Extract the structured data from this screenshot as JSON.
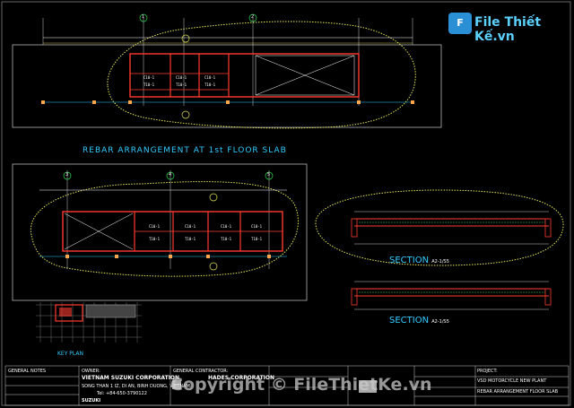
{
  "watermark": {
    "logo_letter": "F",
    "brand": "File Thiết Kế.vn",
    "copyright": "Copyright © FileThietKe.vn"
  },
  "drawing": {
    "top_title": "REBAR ARRANGEMENT AT 1st FLOOR SLAB",
    "section1": "SECTION",
    "section1_ref": "A2-1/S5",
    "section2": "SECTION",
    "section2_ref": "A2-1/S5",
    "key_plan": "KEY PLAN",
    "grid_bubbles": [
      "1",
      "2",
      "3",
      "4",
      "5"
    ]
  },
  "title_block": {
    "general_notes": "GENERAL NOTES",
    "owner_label": "OWNER:",
    "owner_name": "VIETNAM SUZUKI CORPORATION",
    "owner_addr": "SONG THAN 1 IZ, DI AN, BINH DUONG, VIETNAM",
    "owner_tel": "Tel: +84-650-3790122",
    "owner_logo": "SUZUKI",
    "contractor_label": "GENERAL CONTRACTOR:",
    "contractor_name": "HADES CORPORATION",
    "project_label": "PROJECT:",
    "project_name": "VSD MOTORCYCLE NEW PLANT",
    "drawing_name": "REBAR ARRANGEMENT FLOOR SLAB"
  },
  "colors": {
    "background": "#000000",
    "beam": "#ff3b30",
    "grid": "#ffffff",
    "dim": "#ffee55",
    "text_accent": "#33ccff",
    "cloud": "#e6e65a",
    "green": "#33dd55"
  }
}
